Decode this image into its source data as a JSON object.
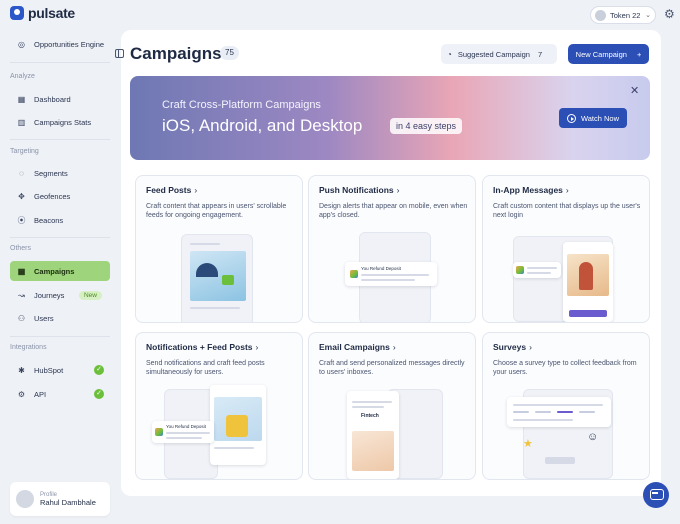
{
  "app": {
    "logo": "pulsate",
    "token_label": "Token 22"
  },
  "sidebar": {
    "top_item": "Opportunities Engine",
    "sections": {
      "analyze": "Analyze",
      "targeting": "Targeting",
      "others": "Others",
      "integrations": "Integrations"
    },
    "items": {
      "dashboard": "Dashboard",
      "campaigns_stats": "Campaigns Stats",
      "segments": "Segments",
      "geofences": "Geofences",
      "beacons": "Beacons",
      "campaigns": "Campaigns",
      "journeys": "Journeys",
      "journeys_badge": "New",
      "users": "Users",
      "hubspot": "HubSpot",
      "api": "API"
    },
    "profile": {
      "label": "Profile",
      "name": "Rahul Dambhale"
    }
  },
  "header": {
    "title": "Campaigns",
    "count": "75",
    "suggested_label": "Suggested Campaign",
    "suggested_count": "7",
    "new_button": "New Campaign",
    "new_button_icon": "+"
  },
  "banner": {
    "subtitle": "Craft Cross-Platform Campaigns",
    "headline": "iOS, Android, and Desktop",
    "steps": "in 4 easy steps",
    "watch_button": "Watch Now",
    "close": "✕"
  },
  "cards": [
    {
      "title": "Feed Posts",
      "desc": "Craft content that appears in users' scrollable feeds for ongoing engagement."
    },
    {
      "title": "Push Notifications",
      "desc": "Design alerts that appear on mobile, even when app's closed."
    },
    {
      "title": "In-App Messages",
      "desc": "Craft custom content that displays up the user's next login"
    },
    {
      "title": "Notifications + Feed Posts",
      "desc": "Send notifications and craft feed posts simultaneously for users."
    },
    {
      "title": "Email Campaigns",
      "desc": "Craft and send personalized messages directly to users' inboxes."
    },
    {
      "title": "Surveys",
      "desc": "Choose a survey type to collect feedback from your users."
    }
  ],
  "mockups": {
    "refund_label": "You Refund Deposit",
    "fintech_label": "Fintech"
  },
  "colors": {
    "primary": "#2c4fb6",
    "active_nav": "#9ed47b",
    "success": "#6bbf3a"
  }
}
